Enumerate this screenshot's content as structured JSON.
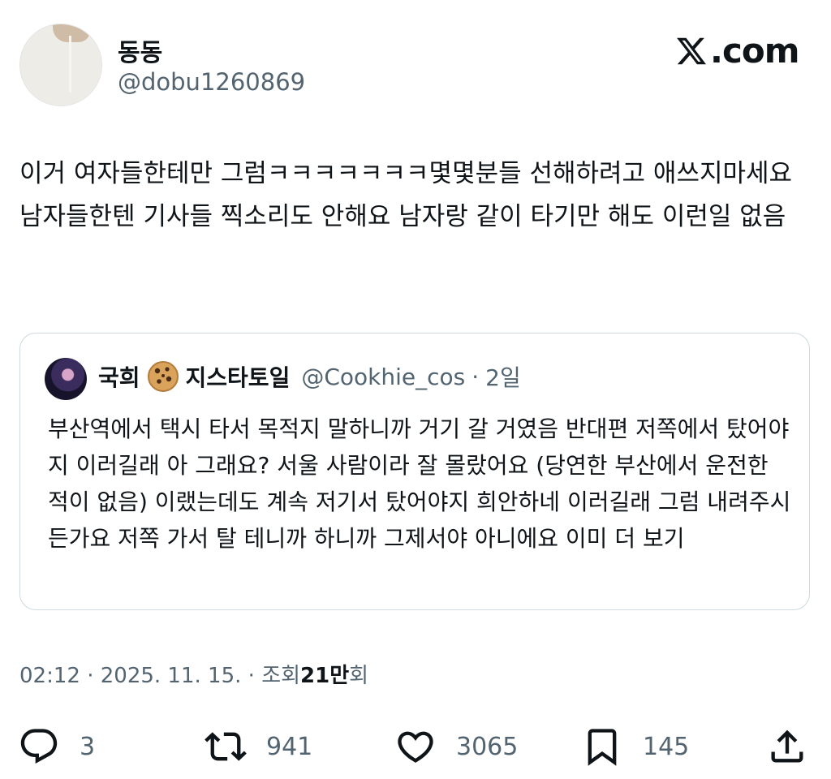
{
  "author": {
    "display_name": "동동",
    "handle": "@dobu1260869"
  },
  "brand": {
    "label": ".com",
    "logo_icon": "x-logo-icon"
  },
  "tweet": {
    "text": "이거 여자들한테만 그럼ㅋㅋㅋㅋㅋㅋㅋ몇몇분들 선해하려고 애쓰지마세요 남자들한텐 기사들 찍소리도 안해요 남자랑 같이 타기만 해도 이런일 없음"
  },
  "quote": {
    "display_name": "국희",
    "emoji_icon": "cookie-icon",
    "name_suffix": "지스타토일",
    "handle": "@Cookhie_cos",
    "separator": "·",
    "age": "2일",
    "text": "부산역에서 택시 타서 목적지 말하니까 거기 갈 거였음 반대편 저쪽에서 탔어야지 이러길래 아 그래요? 서울 사람이라 잘 몰랐어요 (당연한 부산에서 운전한 적이 없음) 이랬는데도 계속 저기서 탔어야지 희안하네 이러길래 그럼 내려주시든가요 저쪽 가서 탈 테니까 하니까 그제서야 아니에요 이미 더 보기"
  },
  "meta": {
    "time": "02:12",
    "sep1": "·",
    "date": "2025. 11. 15.",
    "sep2": "·",
    "views_label": "조회",
    "views_value": "21만",
    "views_suffix": "회"
  },
  "actions": {
    "replies": "3",
    "reposts": "941",
    "likes": "3065",
    "bookmarks": "145"
  },
  "icons": [
    "reply-icon",
    "repost-icon",
    "like-icon",
    "bookmark-icon",
    "share-icon"
  ]
}
